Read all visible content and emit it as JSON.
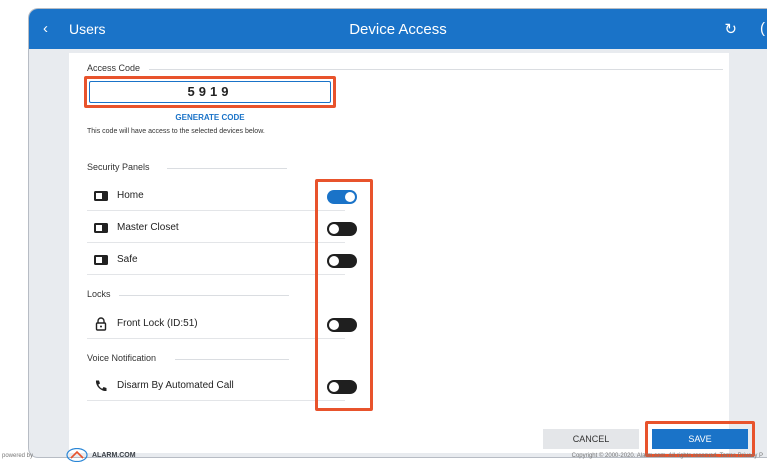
{
  "topbar": {
    "back_label": "Users",
    "title": "Device Access",
    "back_glyph": "‹",
    "refresh_glyph": "↻",
    "edge_glyph": "("
  },
  "access_code": {
    "section_label": "Access Code",
    "value": "5919",
    "generate_label": "GENERATE CODE",
    "helper_text": "This code will have access to the selected devices below."
  },
  "sections": {
    "security_panels": {
      "label": "Security Panels",
      "items": [
        {
          "label": "Home",
          "icon": "panel-icon",
          "enabled": true
        },
        {
          "label": "Master Closet",
          "icon": "panel-icon",
          "enabled": false
        },
        {
          "label": "Safe",
          "icon": "panel-icon",
          "enabled": false
        }
      ]
    },
    "locks": {
      "label": "Locks",
      "items": [
        {
          "label": "Front Lock (ID:51)",
          "icon": "lock-icon",
          "enabled": false
        }
      ]
    },
    "voice_notification": {
      "label": "Voice Notification",
      "items": [
        {
          "label": "Disarm By Automated Call",
          "icon": "phone-icon",
          "enabled": false
        }
      ]
    }
  },
  "actions": {
    "cancel_label": "CANCEL",
    "save_label": "SAVE"
  },
  "footer": {
    "powered_by": "powered by",
    "brand": "ALARM.COM",
    "copyright": "Copyright © 2000-2020. Alarm.com. All rights reserved.   Terms   Privacy P"
  },
  "colors": {
    "primary": "#1a73c8",
    "highlight": "#e8532c",
    "toggle_off": "#1f1f1f"
  }
}
